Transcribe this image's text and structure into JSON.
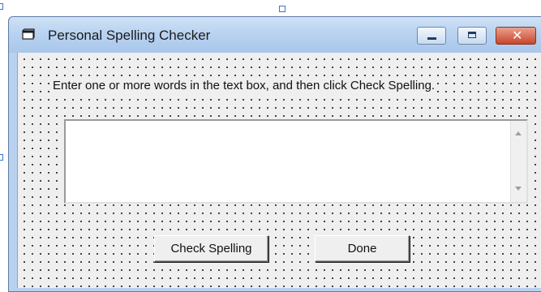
{
  "window": {
    "title": "Personal Spelling Checker",
    "icon": "form-icon",
    "controls": [
      "minimize-icon",
      "maximize-icon",
      "close-icon"
    ]
  },
  "form": {
    "instruction": "Enter one or more words in the text box, and then click Check Spelling.",
    "textbox_value": "",
    "check_button": "Check Spelling",
    "done_button": "Done"
  },
  "colors": {
    "titlebar": "#b9d3f0",
    "client_bg": "#efefef",
    "close_button": "#c8452b",
    "selection_handle": "#3a72d6"
  }
}
